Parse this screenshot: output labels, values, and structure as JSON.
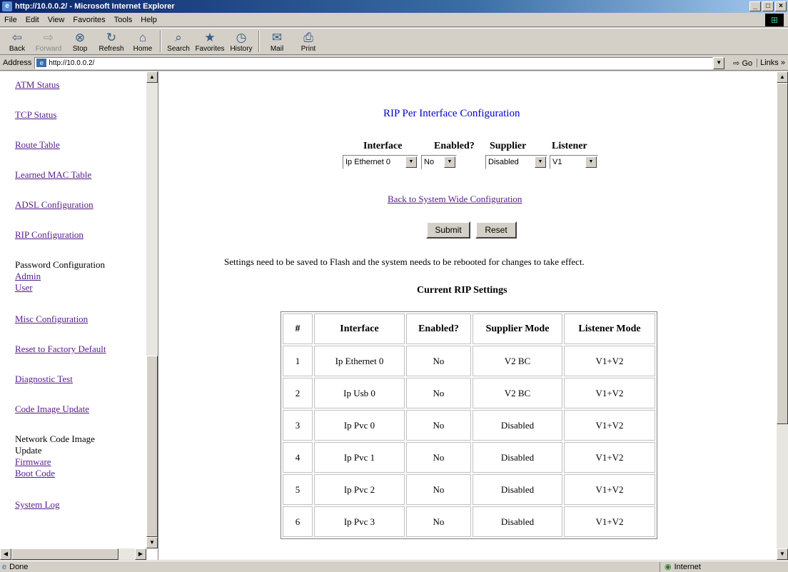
{
  "window": {
    "title": "http://10.0.0.2/ - Microsoft Internet Explorer",
    "buttons": [
      "_",
      "□",
      "×"
    ]
  },
  "menu": [
    "File",
    "Edit",
    "View",
    "Favorites",
    "Tools",
    "Help"
  ],
  "toolbar": {
    "buttons": [
      {
        "label": "Back",
        "icon": "back-arrow-icon",
        "glyph": "⇦"
      },
      {
        "label": "Forward",
        "icon": "forward-arrow-icon",
        "glyph": "⇨"
      },
      {
        "label": "Stop",
        "icon": "stop-icon",
        "glyph": "⊗"
      },
      {
        "label": "Refresh",
        "icon": "refresh-icon",
        "glyph": "↻"
      },
      {
        "label": "Home",
        "icon": "home-icon",
        "glyph": "⌂"
      },
      {
        "label": "Search",
        "icon": "search-icon",
        "glyph": "⌕"
      },
      {
        "label": "Favorites",
        "icon": "favorites-icon",
        "glyph": "★"
      },
      {
        "label": "History",
        "icon": "history-icon",
        "glyph": "◷"
      },
      {
        "label": "Mail",
        "icon": "mail-icon",
        "glyph": "✉"
      },
      {
        "label": "Print",
        "icon": "print-icon",
        "glyph": "⎙"
      }
    ]
  },
  "address": {
    "label": "Address",
    "url": "http://10.0.0.2/",
    "go": "Go",
    "links": "Links"
  },
  "sidebar": {
    "items": [
      {
        "label": "ATM Status",
        "link": true
      },
      {
        "label": "TCP Status",
        "link": true
      },
      {
        "label": "Route Table",
        "link": true
      },
      {
        "label": "Learned MAC Table",
        "link": true
      },
      {
        "label": "ADSL Configuration",
        "link": true
      },
      {
        "label": "RIP Configuration",
        "link": true
      },
      {
        "label": "Password Configuration",
        "link": false
      },
      {
        "label": "Admin",
        "link": true
      },
      {
        "label": "User",
        "link": true
      },
      {
        "label": "Misc Configuration",
        "link": true
      },
      {
        "label": "Reset to Factory Default",
        "link": true
      },
      {
        "label": "Diagnostic Test",
        "link": true
      },
      {
        "label": "Code Image Update",
        "link": true
      },
      {
        "label": "Network Code Image",
        "link": false
      },
      {
        "label": "Update",
        "link": false
      },
      {
        "label": "Firmware",
        "link": true
      },
      {
        "label": "Boot Code",
        "link": true
      },
      {
        "label": "System Log",
        "link": true
      }
    ]
  },
  "main": {
    "title": "RIP Per Interface Configuration",
    "form": {
      "headers": [
        "Interface",
        "Enabled?",
        "Supplier",
        "Listener"
      ],
      "values": [
        "Ip Ethernet 0",
        "No",
        "Disabled",
        "V1"
      ]
    },
    "back_link": "Back to System Wide Configuration",
    "submit": "Submit",
    "reset": "Reset",
    "notice": "Settings need to be saved to Flash and the system needs to be rebooted for changes to take effect.",
    "table_title": "Current RIP Settings",
    "table": {
      "columns": [
        "#",
        "Interface",
        "Enabled?",
        "Supplier Mode",
        "Listener Mode"
      ],
      "rows": [
        [
          "1",
          "Ip Ethernet 0",
          "No",
          "V2 BC",
          "V1+V2"
        ],
        [
          "2",
          "Ip Usb 0",
          "No",
          "V2 BC",
          "V1+V2"
        ],
        [
          "3",
          "Ip Pvc 0",
          "No",
          "Disabled",
          "V1+V2"
        ],
        [
          "4",
          "Ip Pvc 1",
          "No",
          "Disabled",
          "V1+V2"
        ],
        [
          "5",
          "Ip Pvc 2",
          "No",
          "Disabled",
          "V1+V2"
        ],
        [
          "6",
          "Ip Pvc 3",
          "No",
          "Disabled",
          "V1+V2"
        ]
      ]
    }
  },
  "status": {
    "left": "Done",
    "zone": "Internet"
  }
}
